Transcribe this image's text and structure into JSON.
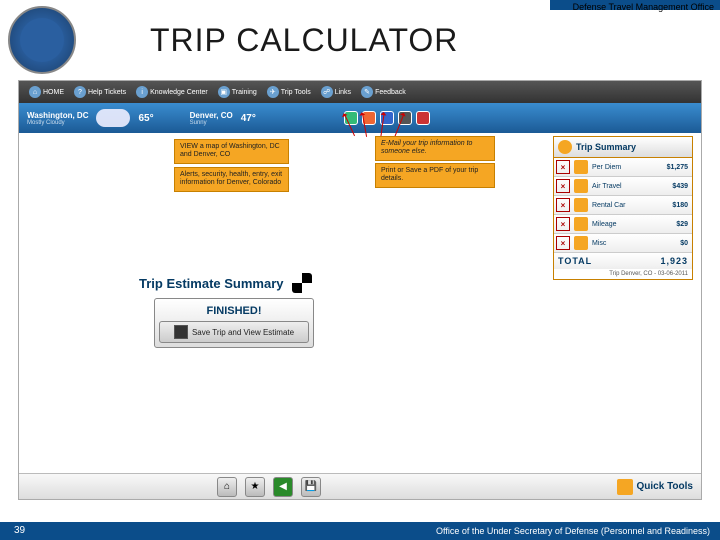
{
  "header": {
    "office": "Defense Travel Management Office",
    "title": "TRIP CALCULATOR"
  },
  "nav": {
    "items": [
      {
        "icon": "home-icon",
        "label": "HOME"
      },
      {
        "icon": "help-icon",
        "label": "Help Tickets"
      },
      {
        "icon": "info-icon",
        "label": "Knowledge Center"
      },
      {
        "icon": "training-icon",
        "label": "Training"
      },
      {
        "icon": "tools-icon",
        "label": "Trip Tools"
      },
      {
        "icon": "links-icon",
        "label": "Links"
      },
      {
        "icon": "feedback-icon",
        "label": "Feedback"
      }
    ]
  },
  "weather": {
    "city1": "Washington, DC",
    "cond1": "Mostly Cloudy",
    "temp1": "65°",
    "city2": "Denver, CO",
    "cond2": "Sunny",
    "temp2": "47°"
  },
  "callouts": {
    "c1": "VIEW a map of Washington, DC and Denver, CO",
    "c2": "Alerts, security, health, entry, exit information for Denver, Colorado",
    "c3": "E-Mail your trip information to someone else.",
    "c4": "Print or Save a PDF of your trip details."
  },
  "summary": {
    "title": "Trip Summary",
    "rows": [
      {
        "label": "Per Diem",
        "value": "$1,275"
      },
      {
        "label": "Air Travel",
        "value": "$439"
      },
      {
        "label": "Rental Car",
        "value": "$180"
      },
      {
        "label": "Mileage",
        "value": "$29"
      },
      {
        "label": "Misc",
        "value": "$0"
      }
    ],
    "total_label": "TOTAL",
    "total_value": "1,923",
    "note": "Trip Denver, CO - 03-06-2011"
  },
  "estimate": {
    "heading": "Trip Estimate Summary",
    "finished": "FINISHED!",
    "save_btn": "Save Trip and View Estimate"
  },
  "quick_tools": "Quick Tools",
  "footer": {
    "page": "39",
    "text": "Office of the Under Secretary of Defense (Personnel and Readiness)"
  }
}
